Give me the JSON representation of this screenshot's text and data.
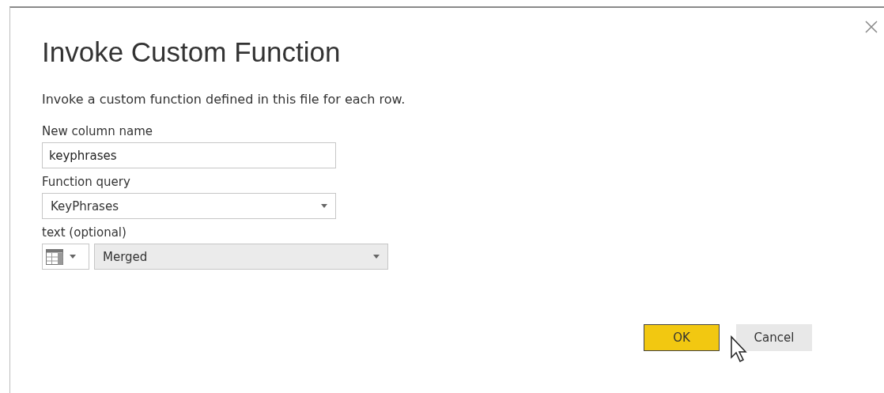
{
  "dialog": {
    "title": "Invoke Custom Function",
    "description": "Invoke a custom function defined in this file for each row.",
    "fields": [
      {
        "kind": "text",
        "label": "New column name",
        "value": "keyphrases"
      },
      {
        "kind": "dropdown",
        "label": "Function query",
        "value": "KeyPhrases",
        "disabled": false
      },
      {
        "kind": "column-dropdown",
        "label": "text (optional)",
        "value": "Merged",
        "disabled": true
      }
    ],
    "buttons": [
      {
        "label": "OK",
        "primary": true
      },
      {
        "label": "Cancel",
        "primary": false
      }
    ]
  }
}
